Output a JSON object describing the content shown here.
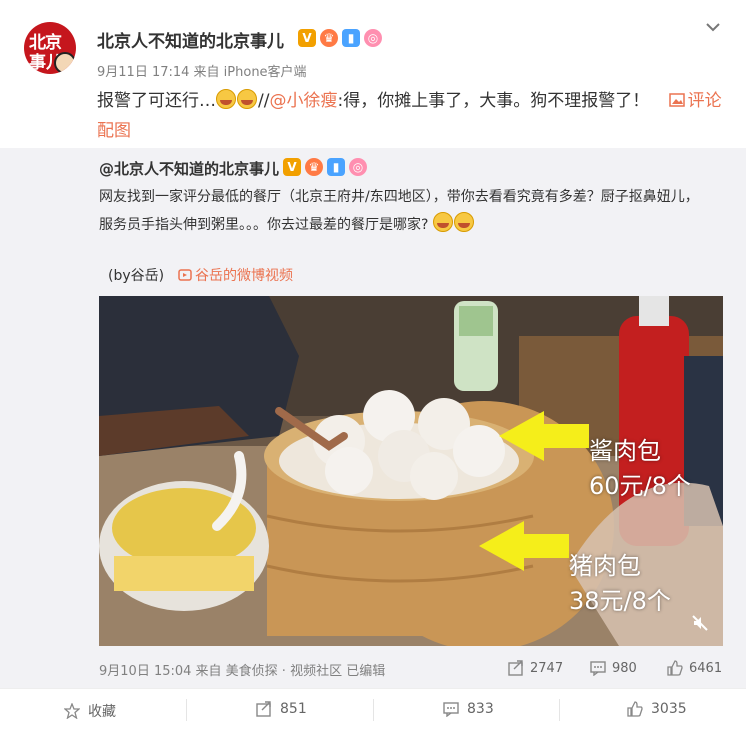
{
  "post": {
    "author": "北京人不知道的北京事儿",
    "avatar_text_1": "北京",
    "avatar_text_2": "事儿",
    "time": "9月11日 17:14 来自 iPhone客户端",
    "text_1": "报警了可还行…",
    "text_2": "//",
    "mention": "@小徐瘦",
    "text_3": ":得，你摊上事了，大事。狗不理报警了！",
    "image_link": "评论配图"
  },
  "repost": {
    "author": "@北京人不知道的北京事儿",
    "text": "网友找到一家评分最低的餐厅（北京王府井/东四地区），带你去看看究竟有多差？厨子抠鼻妞儿，服务员手指头伸到粥里。。。你去过最差的餐厅是哪家?",
    "by": "(by谷岳)",
    "video_link": "谷岳的微博视频",
    "meta": "9月10日 15:04 来自 美食侦探 · 视频社区 已编辑",
    "reposts": "2747",
    "comments": "980",
    "likes": "6461",
    "video_annotations": {
      "item1_name": "酱肉包",
      "item1_price": "60元/8个",
      "item2_name": "猪肉包",
      "item2_price": "38元/8个"
    }
  },
  "actions": {
    "favorite": "收藏",
    "forward": "851",
    "comment": "833",
    "like": "3035"
  },
  "colors": {
    "accent": "#eb7350",
    "repost_bg": "#f2f2f5",
    "brand_red": "#c5161d"
  }
}
